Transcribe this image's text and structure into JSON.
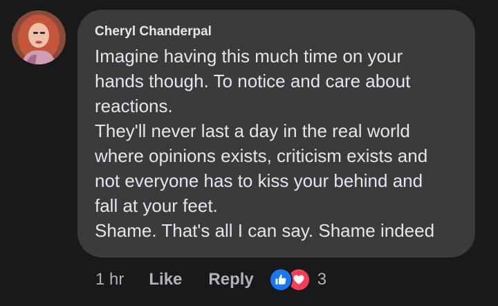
{
  "comment": {
    "author": "Cheryl Chanderpal",
    "text": "Imagine having this much time on your\nhands though. To notice and care about\nreactions.\nThey'll never last a day in the real world\nwhere opinions exists, criticism exists and\nnot everyone has to kiss your behind and\nfall at your feet.\nShame. That's all I can say. Shame indeed",
    "avatar_icon": "profile-photo"
  },
  "actions": {
    "time": "1 hr",
    "like_label": "Like",
    "reply_label": "Reply",
    "reaction_icons": [
      "thumbs-up-icon",
      "heart-icon"
    ],
    "reaction_count": "3"
  },
  "colors": {
    "background": "#18191a",
    "bubble": "#3a3b3c",
    "text": "#e4e6eb",
    "secondary_text": "#b0b3b8",
    "like_blue": "#1877f2",
    "love_red": "#f33e58"
  }
}
